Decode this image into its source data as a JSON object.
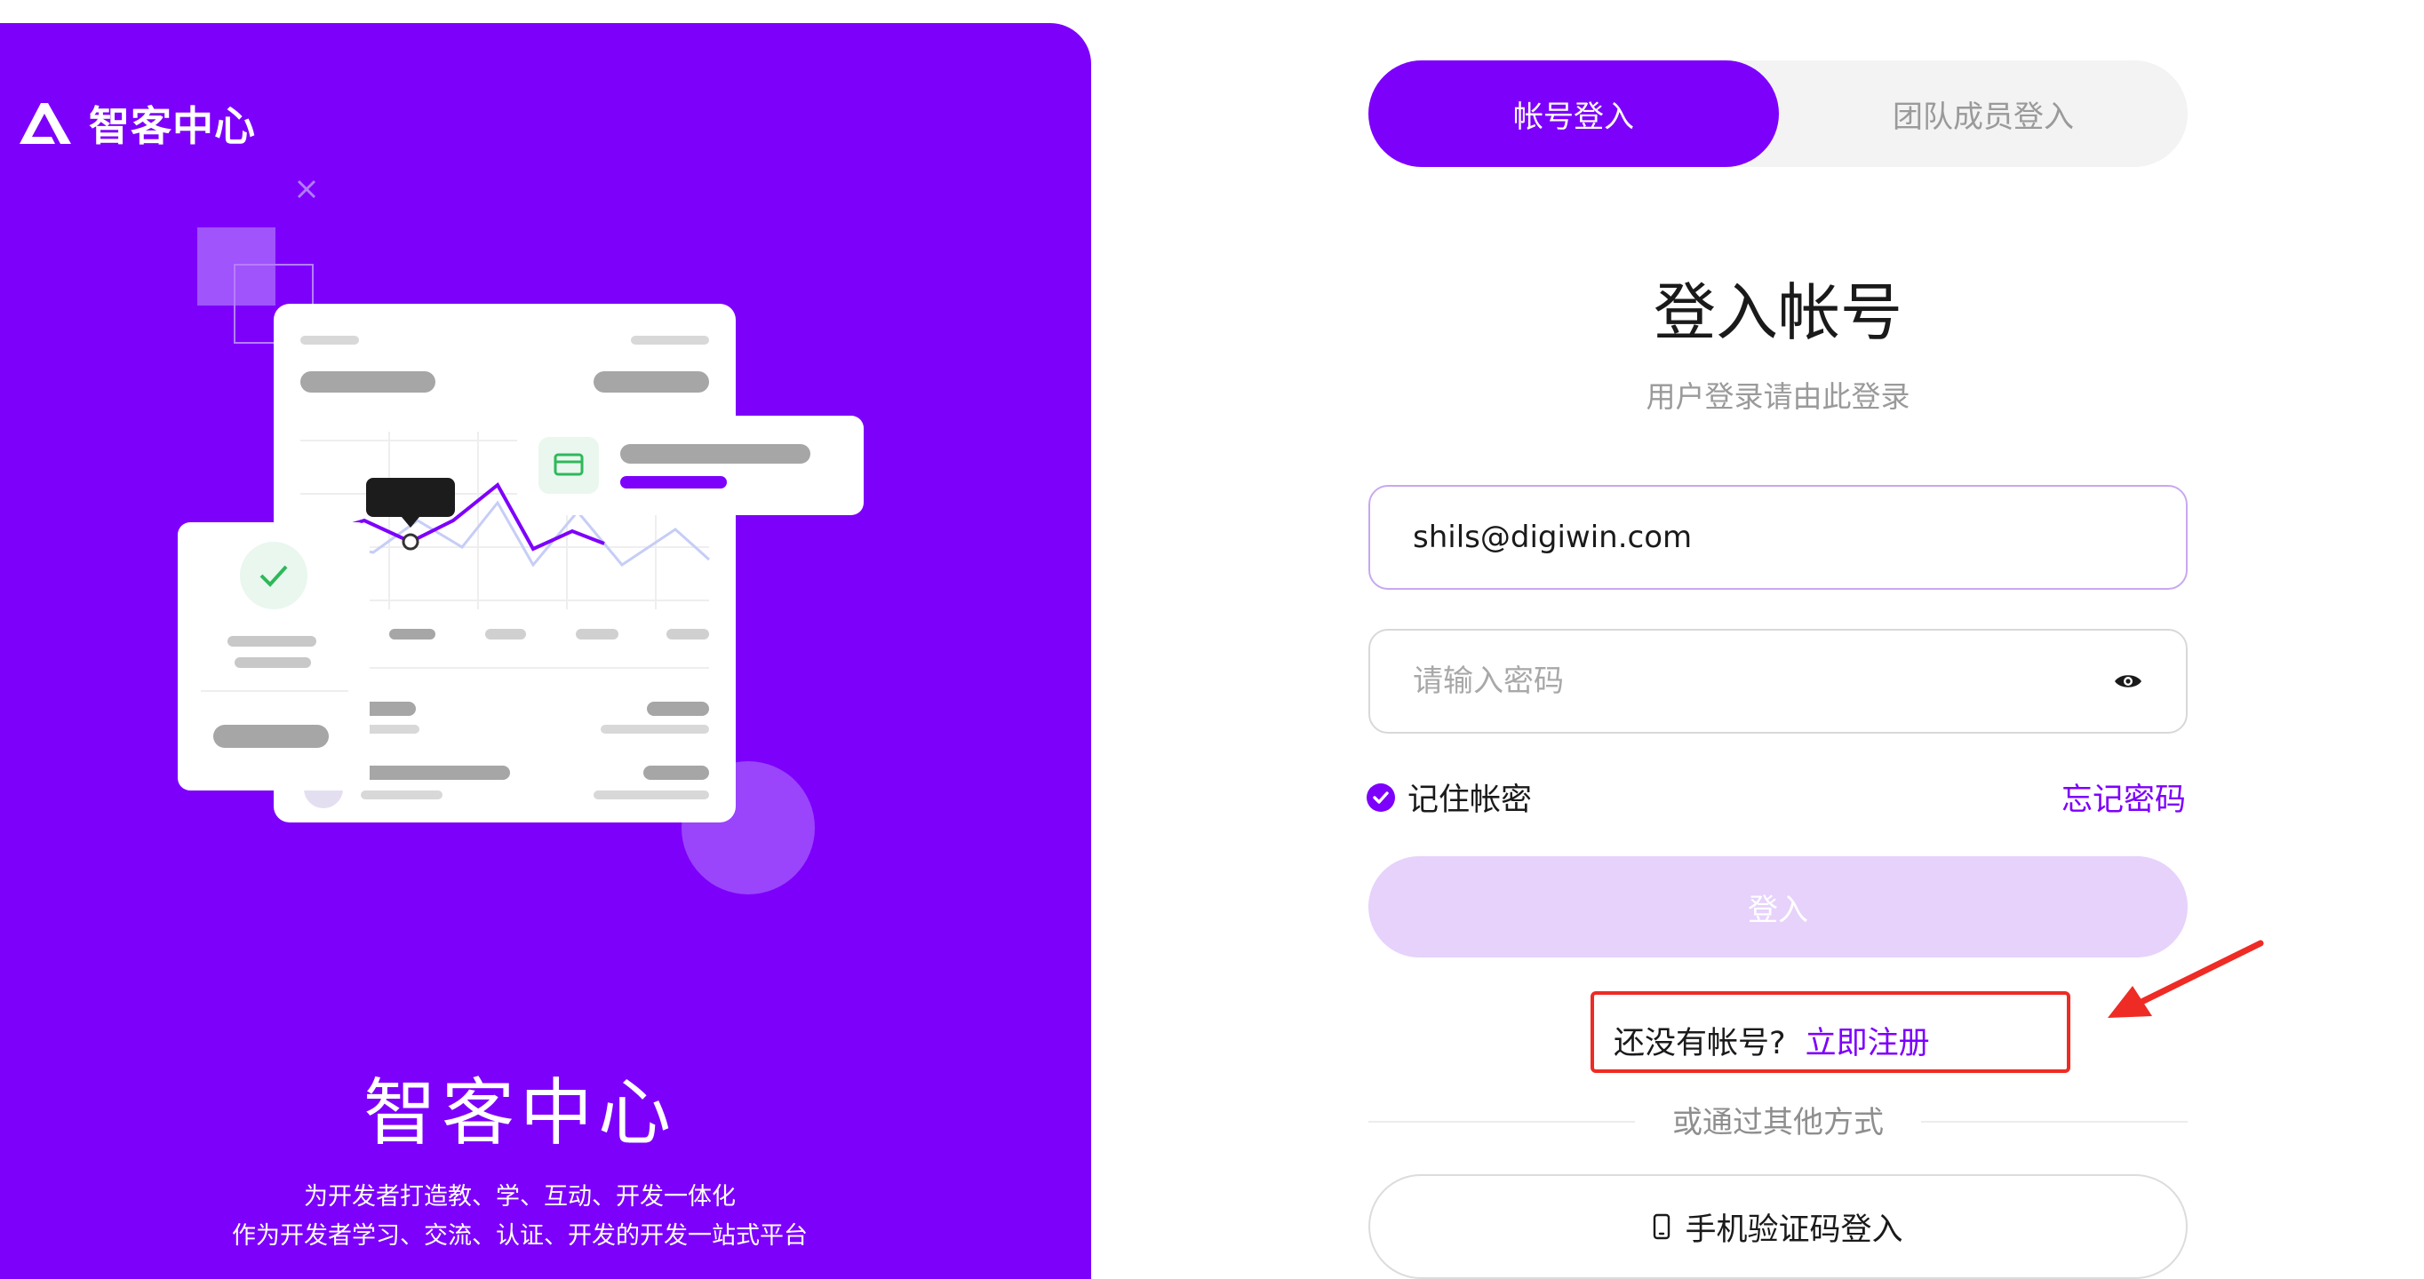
{
  "brand": {
    "name": "智客中心",
    "logo_icon": "brand-a-logo"
  },
  "hero": {
    "title": "智客中心",
    "subtitle_line1": "为开发者打造教、学、互动、开发一体化",
    "subtitle_line2": "作为开发者学习、交流、认证、开发的开发一站式平台"
  },
  "tabs": [
    {
      "label": "帐号登入",
      "active": true
    },
    {
      "label": "团队成员登入",
      "active": false
    }
  ],
  "form": {
    "title": "登入帐号",
    "subtitle": "用户登录请由此登录",
    "email_value": "shils@digiwin.com",
    "password_placeholder": "请输入密码",
    "remember_label": "记住帐密",
    "remember_checked": true,
    "forgot_label": "忘记密码",
    "login_label": "登入",
    "register_question": "还没有帐号?",
    "register_link": "立即注册",
    "divider_text": "或通过其他方式",
    "phone_login_label": "手机验证码登入"
  },
  "colors": {
    "brand_purple": "#7d00fb",
    "login_disabled": "#e6d2fb",
    "annotation_red": "#ee2b24"
  }
}
